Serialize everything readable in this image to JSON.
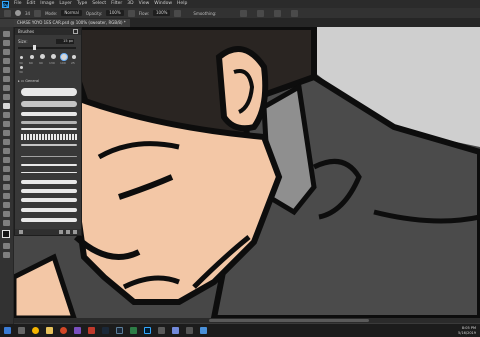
{
  "menubar": {
    "app_logo": "Ps",
    "items": [
      "File",
      "Edit",
      "Image",
      "Layer",
      "Type",
      "Select",
      "Filter",
      "3D",
      "View",
      "Window",
      "Help"
    ]
  },
  "options": {
    "brush_size": "34",
    "mode_label": "Mode:",
    "mode_value": "Normal",
    "opacity_label": "Opacity:",
    "opacity_value": "100%",
    "flow_label": "Flow:",
    "flow_value": "100%",
    "smoothing_label": "Smoothing:"
  },
  "document_tab": {
    "title": "CHASE YOYO 1ES CAR.psd @ 100% (sweater, RGB/8) *"
  },
  "brush_panel": {
    "title": "Brushes",
    "size_label": "Size:",
    "size_value": "15 px",
    "preset_sizes": [
      "30",
      "60",
      "90",
      "130",
      "100",
      "25",
      "30"
    ],
    "folder_label": "General"
  },
  "colors": {
    "skin": "#f3c7a6",
    "shirt": "#4b4b4b",
    "outline": "#0d0d0d",
    "ui_dark": "#323232",
    "accent": "#31a8ff"
  },
  "taskbar": {
    "time": "8:05 PM",
    "date": "5/16/2019"
  }
}
